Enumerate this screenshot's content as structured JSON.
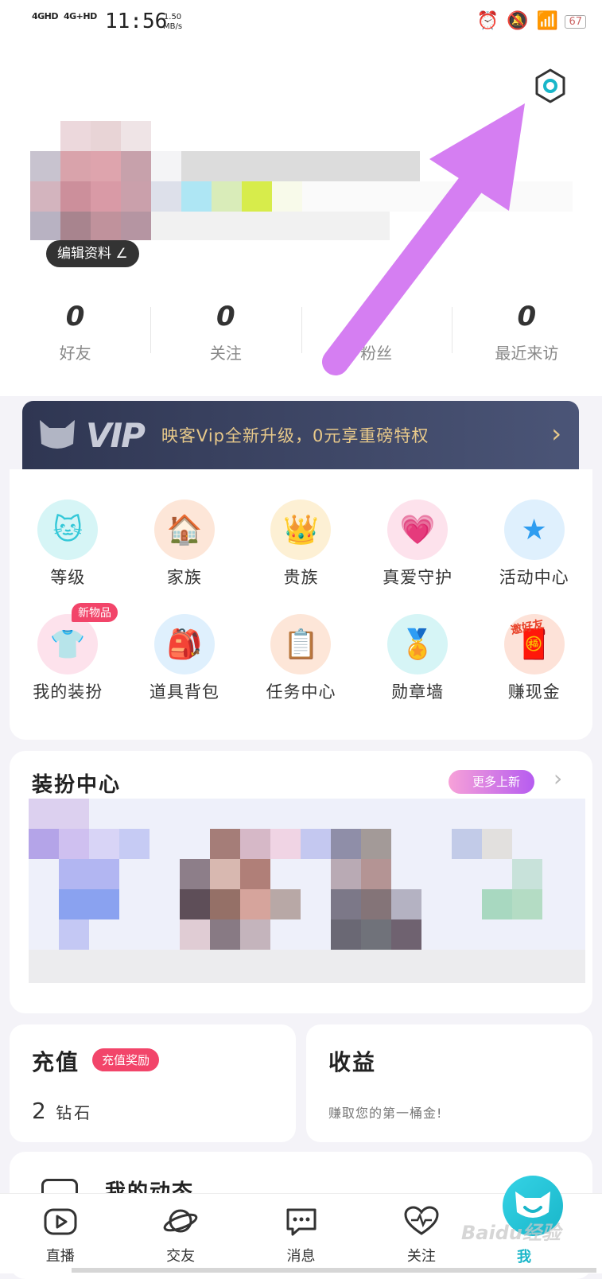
{
  "status_bar": {
    "network_1": "4GHD",
    "network_2": "4G+HD",
    "time": "11:56",
    "speed_value": "1.50",
    "speed_unit": "MB/s",
    "battery": "67"
  },
  "stats": [
    {
      "value": "0",
      "label": "好友"
    },
    {
      "value": "0",
      "label": "关注"
    },
    {
      "value": "0",
      "label": "粉丝"
    },
    {
      "value": "0",
      "label": "最近来访"
    }
  ],
  "profile": {
    "edit_label": "编辑资料"
  },
  "vip": {
    "logo_text": "VIP",
    "message": "映客Vip全新升级，0元享重磅特权"
  },
  "features": [
    {
      "label": "等级",
      "icon": "cat-face-icon",
      "bg": "#d6f5f6",
      "fg": "#34c8d8"
    },
    {
      "label": "家族",
      "icon": "house-icon",
      "bg": "#fde6d8",
      "fg": "#f08a3c"
    },
    {
      "label": "贵族",
      "icon": "crown-icon",
      "bg": "#fdf0d4",
      "fg": "#f4b026"
    },
    {
      "label": "真爱守护",
      "icon": "heart-wings-icon",
      "bg": "#fde2ec",
      "fg": "#f05a8c"
    },
    {
      "label": "活动中心",
      "icon": "star-icon",
      "bg": "#dff0fd",
      "fg": "#2f9df0"
    },
    {
      "label": "我的装扮",
      "icon": "tshirt-icon",
      "bg": "#fde2ec",
      "fg": "#f05a8c",
      "badge": "新物品"
    },
    {
      "label": "道具背包",
      "icon": "backpack-icon",
      "bg": "#dff0fd",
      "fg": "#2f9df0"
    },
    {
      "label": "任务中心",
      "icon": "task-calendar-icon",
      "bg": "#fde6d8",
      "fg": "#f08a3c"
    },
    {
      "label": "勋章墙",
      "icon": "medal-icon",
      "bg": "#d6f5f6",
      "fg": "#34c8d8"
    },
    {
      "label": "赚现金",
      "icon": "red-envelope-icon",
      "bg": "#fde2d8",
      "fg": "#e8432a",
      "overlay_text": "邀好友"
    }
  ],
  "dress_center": {
    "title": "装扮中心",
    "more_label": "更多上新"
  },
  "recharge": {
    "title": "充值",
    "badge": "充值奖励",
    "amount": "2",
    "unit": "钻石"
  },
  "income": {
    "title": "收益",
    "subtitle": "赚取您的第一桶金!"
  },
  "moments": {
    "title": "我的动态"
  },
  "bottom_nav": [
    {
      "label": "直播",
      "icon": "live-tv-icon"
    },
    {
      "label": "交友",
      "icon": "planet-icon"
    },
    {
      "label": "消息",
      "icon": "message-icon"
    },
    {
      "label": "关注",
      "icon": "heart-pulse-icon"
    },
    {
      "label": "我",
      "icon": "me-cat-icon"
    }
  ],
  "watermark": "Baidu经验",
  "colors": {
    "accent_teal": "#19b6c9",
    "badge_red": "#f2456a",
    "vip_gold": "#e8c98a",
    "annotation_arrow": "#d57ef2"
  }
}
